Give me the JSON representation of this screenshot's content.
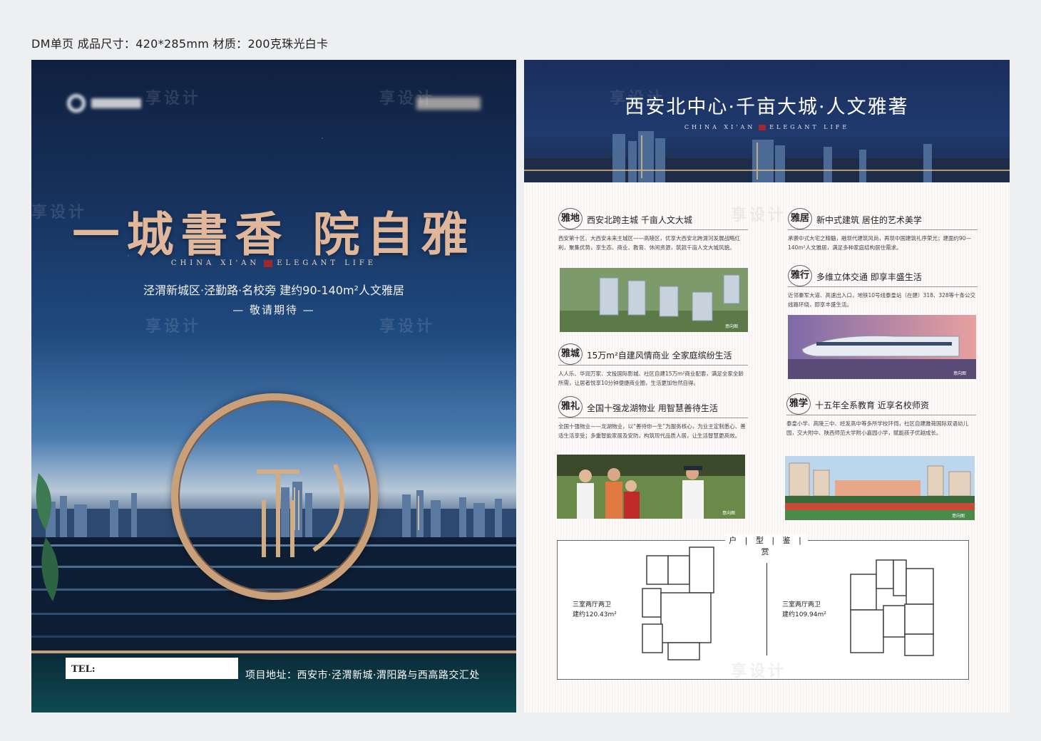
{
  "spec_line": "DM单页  成品尺寸：420*285mm  材质：200克珠光白卡",
  "watermark": "享设计",
  "left": {
    "headline": "一城書香 院自雅",
    "subline_left": "CHINA XI'AN",
    "subline_right": "ELEGANT LIFE",
    "location": "泾渭新城区·泾勤路·名校旁 建约90-140m²人文雅居",
    "expect": "— 敬请期待 —",
    "tel_label": "TEL:",
    "address": "项目地址：西安市·泾渭新城·渭阳路与西高路交汇处"
  },
  "right": {
    "banner_title": "西安北中心·千亩大城·人文雅著",
    "banner_sub_left": "CHINA XI'AN",
    "banner_sub_right": "ELEGANT LIFE",
    "cards": [
      {
        "icon": "雅地",
        "title": "西安北跨主城 千亩人文大城",
        "body": "西安第十区、大西安未来主城区——高陵区，优享大西安北跨渭河发展战略红利，聚集优势，享生态、商业、教育、休闲资源，筑就千亩人文大城风貌。"
      },
      {
        "icon": "雅居",
        "title": "新中式建筑 居住的艺术美学",
        "body": "承袭中式大宅之精髓，融现代建筑风尚，再现中国建筑礼序荣光；建面约90—140m²人文雅居，满足多种家庭结构居住需求。"
      },
      {
        "icon": "雅行",
        "title": "多维立体交通 即享丰盛生活",
        "body": "近邻秦军大道、高速出入口，地铁10号线泰皇站（在建）318、328等十条公交线路环绕，即享丰盛生活。"
      },
      {
        "icon": "雅城",
        "title": "15万m²自建风情商业 全家庭缤纷生活",
        "body": "人人乐、华润万家、文投国际影城、社区自建15万m²商业配套，满足全家全龄所需，让居者悦享10分钟便捷商业圈，生活更加怡然自得。"
      },
      {
        "icon": "雅礼",
        "title": "全国十强龙湖物业 用智慧善待生活",
        "body": "全国十强物业——龙湖物业，以“善待你一生”为服务核心，为业主定制悉心、善适生活享受；多重智能家居及安防，构筑现代品质人居，让生活智慧更高效。"
      },
      {
        "icon": "雅学",
        "title": "十五年全系教育 近享名校师资",
        "body": "泰皇小学、高陵三中、经发高中等多所学校环伺，社区自建雅荷国际双语幼儿园，交大附中、陕西师范大学附小嘉园小学，赋能孩子优越成长。"
      }
    ],
    "photo_caption": "意向图",
    "floor_tab": "户 | 型 | 鉴 | 赏",
    "plans": [
      {
        "type": "三室两厅两卫",
        "area": "建约120.43m²"
      },
      {
        "type": "三室两厅两卫",
        "area": "建约109.94m²"
      }
    ]
  }
}
